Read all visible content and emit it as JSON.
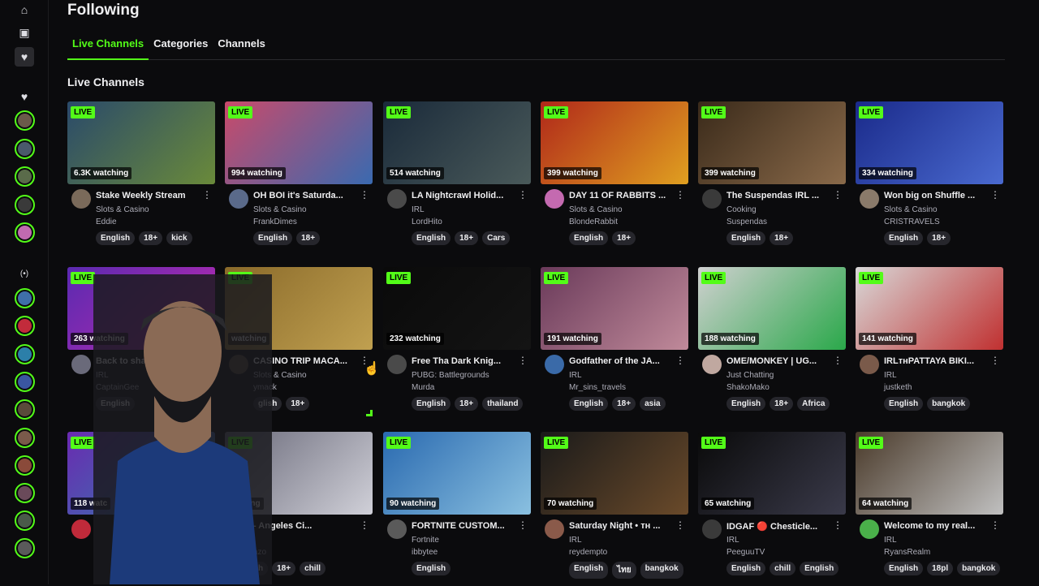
{
  "page": {
    "title": "Following"
  },
  "tabs": [
    {
      "label": "Live Channels",
      "active": true
    },
    {
      "label": "Categories",
      "active": false
    },
    {
      "label": "Channels",
      "active": false
    }
  ],
  "section": {
    "title": "Live Channels"
  },
  "sidebar": {
    "live_indicator": "(•)",
    "top_icons": [
      "home-icon",
      "browse-icon",
      "heart-icon"
    ],
    "avatar_colors": [
      "#6b5a4a",
      "#4a5a6b",
      "#5a6b4a",
      "#3a3a3a",
      "#c06ab0",
      "#3f6fa8",
      "#c22b3b",
      "#2c7fa9",
      "#3a56a1",
      "#5a4a3a",
      "#7a5a4a",
      "#8a4a3a",
      "#6a4a5a",
      "#4a5a4a",
      "#5a5a5a"
    ]
  },
  "accent": "#53fc18",
  "cards": [
    {
      "viewers": "6.3K watching",
      "title": "Stake Weekly Stream",
      "category": "Slots & Casino",
      "channel": "Eddie",
      "tags": [
        "English",
        "18+",
        "kick"
      ],
      "thumb": [
        "#2a4a6a",
        "#6a8a3a"
      ],
      "avatar": "#7a6a5a"
    },
    {
      "viewers": "994 watching",
      "title": "OH BOI it's Saturda...",
      "category": "Slots & Casino",
      "channel": "FrankDimes",
      "tags": [
        "English",
        "18+"
      ],
      "thumb": [
        "#c94a6a",
        "#3a6ab0"
      ],
      "avatar": "#5a6a8a"
    },
    {
      "viewers": "514 watching",
      "title": "LA Nightcrawl Holid...",
      "category": "IRL",
      "channel": "LordHito",
      "tags": [
        "English",
        "18+",
        "Cars"
      ],
      "thumb": [
        "#1a2a3a",
        "#4a5a5a"
      ],
      "avatar": "#4a4a4a"
    },
    {
      "viewers": "399 watching",
      "title": "DAY 11 OF RABBITS ...",
      "category": "Slots & Casino",
      "channel": "BlondeRabbit",
      "tags": [
        "English",
        "18+"
      ],
      "thumb": [
        "#b0281a",
        "#e0a020"
      ],
      "avatar": "#c46ab0"
    },
    {
      "viewers": "399 watching",
      "title": "The Suspendas IRL ...",
      "category": "Cooking",
      "channel": "Suspendas",
      "tags": [
        "English",
        "18+"
      ],
      "thumb": [
        "#3a2a1a",
        "#8a6a4a"
      ],
      "avatar": "#3a3a3a"
    },
    {
      "viewers": "334 watching",
      "title": "Won big on Shuffle ...",
      "category": "Slots & Casino",
      "channel": "CRISTRAVELS",
      "tags": [
        "English",
        "18+"
      ],
      "thumb": [
        "#1a2a8a",
        "#4a6ad0"
      ],
      "avatar": "#8a7a6a"
    },
    {
      "viewers": "263 watching",
      "title": "Back to shape and h...",
      "category": "IRL",
      "channel": "CaptainGee",
      "tags": [
        "English"
      ],
      "thumb": [
        "#5a2ab0",
        "#c02ab0"
      ],
      "avatar": "#6a6a7a"
    },
    {
      "viewers": "watching",
      "title": "CASINO TRIP MACA...",
      "category": "Slots & Casino",
      "channel": "ymack",
      "tags": [
        "glish",
        "18+"
      ],
      "thumb": [
        "#8a6a2a",
        "#c0a050"
      ],
      "avatar": "#5a4a3a"
    },
    {
      "viewers": "232 watching",
      "title": "Free Tha Dark Knig...",
      "category": "PUBG: Battlegrounds",
      "channel": "Murda",
      "tags": [
        "English",
        "18+",
        "thailand"
      ],
      "thumb": [
        "#0a0a0a",
        "#141414"
      ],
      "avatar": "#4a4a4a"
    },
    {
      "viewers": "191 watching",
      "title": "Godfather of the JA...",
      "category": "IRL",
      "channel": "Mr_sins_travels",
      "tags": [
        "English",
        "18+",
        "asia"
      ],
      "thumb": [
        "#6a3a5a",
        "#c08a9a"
      ],
      "avatar": "#3a6aa8"
    },
    {
      "viewers": "188 watching",
      "title": "OME/MONKEY | UG...",
      "category": "Just Chatting",
      "channel": "ShakoMako",
      "tags": [
        "English",
        "18+",
        "Africa"
      ],
      "thumb": [
        "#d0d0d0",
        "#2aa84a"
      ],
      "avatar": "#c0a8a0"
    },
    {
      "viewers": "141 watching",
      "title": "IRLтнPATTAYA BIKI...",
      "category": "IRL",
      "channel": "justketh",
      "tags": [
        "English",
        "bangkok"
      ],
      "thumb": [
        "#d8d8d8",
        "#c03030"
      ],
      "avatar": "#7a5a4a"
    },
    {
      "viewers": "118 watc",
      "title": "",
      "category": "",
      "channel": "",
      "tags": [],
      "thumb": [
        "#6a2ab0",
        "#2a8ab0"
      ],
      "avatar": "#c02a3a"
    },
    {
      "viewers": "atching",
      "title": "- Angeles Ci...",
      "category": "",
      "channel": "azo",
      "tags": [
        "h",
        "18+",
        "chill"
      ],
      "thumb": [
        "#6a6a7a",
        "#d0d0d8"
      ],
      "avatar": "#3a3a3a"
    },
    {
      "viewers": "90 watching",
      "title": "FORTNITE CUSTOM...",
      "category": "Fortnite",
      "channel": "ibbytee",
      "tags": [
        "English"
      ],
      "thumb": [
        "#2a6ab0",
        "#8ac0e0"
      ],
      "avatar": "#5a5a5a"
    },
    {
      "viewers": "70 watching",
      "title": "Saturday Night • тн ...",
      "category": "IRL",
      "channel": "reydempto",
      "tags": [
        "English",
        "ไทย",
        "bangkok"
      ],
      "thumb": [
        "#1a1a1a",
        "#6a4a2a"
      ],
      "avatar": "#8a5a4a"
    },
    {
      "viewers": "65 watching",
      "title": "IDGAF 🔴 Chesticle...",
      "category": "IRL",
      "channel": "PeeguuTV",
      "tags": [
        "English",
        "chill",
        "English"
      ],
      "thumb": [
        "#0a0a0a",
        "#3a3a4a"
      ],
      "avatar": "#3a3a3a"
    },
    {
      "viewers": "64 watching",
      "title": "Welcome to my real...",
      "category": "IRL",
      "channel": "RyansRealm",
      "tags": [
        "English",
        "18pl",
        "bangkok"
      ],
      "thumb": [
        "#4a3a2a",
        "#c0c0c0"
      ],
      "avatar": "#4ab04a"
    }
  ]
}
